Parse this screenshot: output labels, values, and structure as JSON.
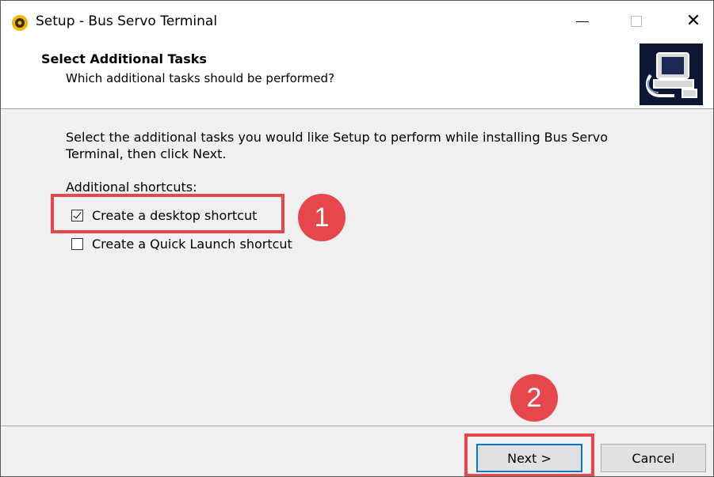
{
  "window": {
    "title": "Setup - Bus Servo Terminal"
  },
  "header": {
    "title": "Select Additional Tasks",
    "subtitle": "Which additional tasks should be performed?"
  },
  "body": {
    "description": "Select the additional tasks you would like Setup to perform while installing Bus Servo Terminal, then click Next.",
    "shortcuts_label": "Additional shortcuts:",
    "options": [
      {
        "label": "Create a desktop shortcut",
        "checked": true
      },
      {
        "label": "Create a Quick Launch shortcut",
        "checked": false
      }
    ]
  },
  "annotations": {
    "step1": "1",
    "step2": "2",
    "highlight_color": "#e5474c"
  },
  "buttons": {
    "next_label": "Next >",
    "cancel_label": "Cancel"
  },
  "icons": {
    "app": "setup-icon",
    "logo": "computer-install-icon"
  }
}
